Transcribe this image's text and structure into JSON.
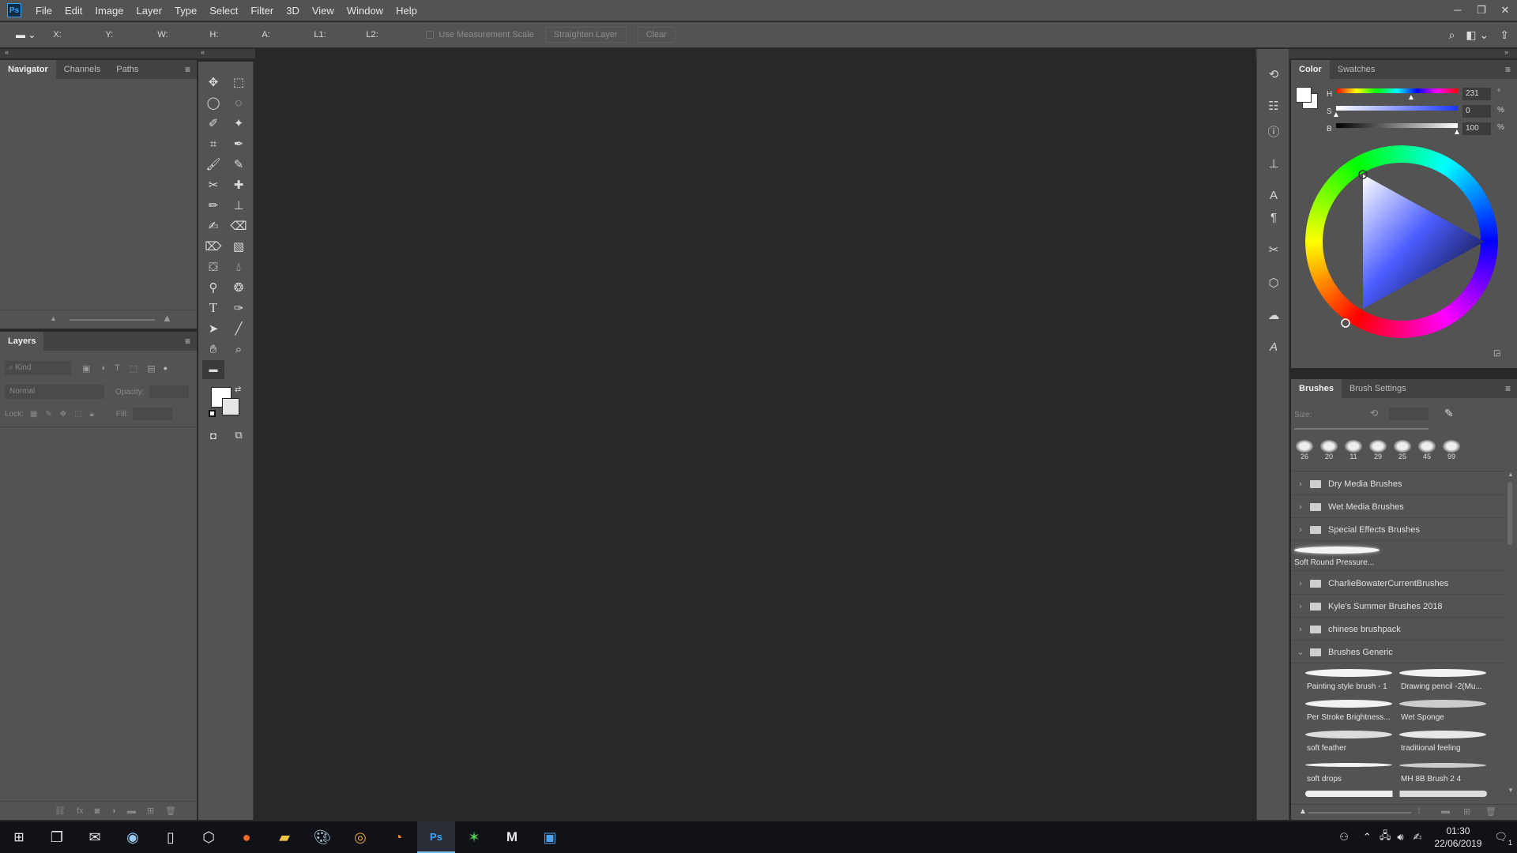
{
  "app": {
    "logo": "Ps"
  },
  "menu": [
    "File",
    "Edit",
    "Image",
    "Layer",
    "Type",
    "Select",
    "Filter",
    "3D",
    "View",
    "Window",
    "Help"
  ],
  "window_controls": [
    "─",
    "❐",
    "✕"
  ],
  "options_bar": {
    "labels": [
      "X:",
      "Y:",
      "W:",
      "H:",
      "A:",
      "L1:",
      "L2:"
    ],
    "checkbox_label": "Use Measurement Scale",
    "straighten_label": "Straighten Layer",
    "clear_label": "Clear"
  },
  "navigator_panel": {
    "tabs": [
      "Navigator",
      "Channels",
      "Paths"
    ]
  },
  "layers_panel": {
    "title": "Layers",
    "kind_placeholder": "Kind",
    "blend_mode": "Normal",
    "opacity_label": "Opacity:",
    "lock_label": "Lock:",
    "fill_label": "Fill:"
  },
  "color_panel": {
    "tabs": [
      "Color",
      "Swatches"
    ],
    "hsb": [
      {
        "label": "H",
        "value": "231",
        "unit": "°"
      },
      {
        "label": "S",
        "value": "0",
        "unit": "%"
      },
      {
        "label": "B",
        "value": "100",
        "unit": "%"
      }
    ],
    "foreground": "#ffffff",
    "background": "#ffffff"
  },
  "brushes_panel": {
    "tabs": [
      "Brushes",
      "Brush Settings"
    ],
    "size_label": "Size:",
    "recent_sizes": [
      "26",
      "20",
      "11",
      "29",
      "25",
      "45",
      "99"
    ],
    "folders_top": [
      "Dry Media Brushes",
      "Wet Media Brushes",
      "Special Effects Brushes"
    ],
    "loose_brush": "Soft Round Pressure...",
    "folders_mid": [
      "CharlieBowaterCurrentBrushes",
      "Kyle's Summer Brushes 2018",
      "chinese brushpack"
    ],
    "open_folder": "Brushes Generic",
    "generic_brushes": [
      "Painting style brush - 1",
      "Drawing pencil -2(Mu...",
      "Per Stroke Brightness...",
      "Wet Sponge",
      "soft feather",
      "traditional feeling",
      "soft drops",
      "MH 8B Brush 2 4"
    ]
  },
  "taskbar": {
    "time": "01:30",
    "date": "22/06/2019",
    "notification_count": "1"
  },
  "colors": {
    "chrome": "#535353",
    "canvas": "#282828",
    "accent": "#31a8ff"
  }
}
